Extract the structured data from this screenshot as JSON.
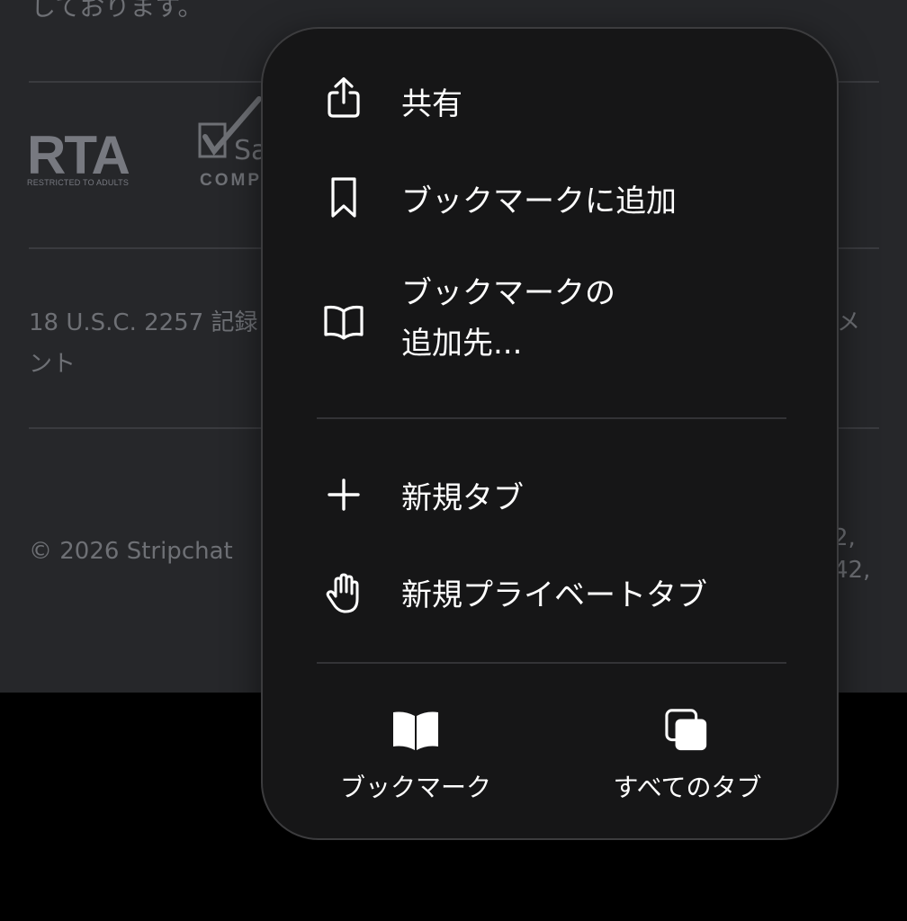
{
  "background": {
    "top_text": "しております。",
    "rta_logo": {
      "big": "RTA",
      "small": "RESTRICTED TO ADULTS"
    },
    "safe_logo": {
      "word": "Sa",
      "badge": "COMP"
    },
    "usc_text_left": "18 U.S.C. 2257 記録",
    "usc_text_right_line1": "メ",
    "usc_text_line2": "ント",
    "copyright_left": "© 2026 Stripchat",
    "copyright_right_line1": "2,",
    "copyright_right_line2": "42,"
  },
  "menu": {
    "items": [
      {
        "label": "共有",
        "icon": "share-icon"
      },
      {
        "label": "ブックマークに追加",
        "icon": "bookmark-icon"
      },
      {
        "label": "ブックマークの\n追加先...",
        "icon": "book-icon"
      },
      {
        "label": "新規タブ",
        "icon": "plus-icon"
      },
      {
        "label": "新規プライベートタブ",
        "icon": "hand-icon"
      }
    ],
    "bottom": [
      {
        "label": "ブックマーク",
        "icon": "book-filled-icon"
      },
      {
        "label": "すべてのタブ",
        "icon": "tabs-icon"
      }
    ]
  },
  "colors": {
    "menu_bg": "#161617",
    "page_bg": "#26272a",
    "text": "#ffffff",
    "muted_text": "#6e7075"
  }
}
